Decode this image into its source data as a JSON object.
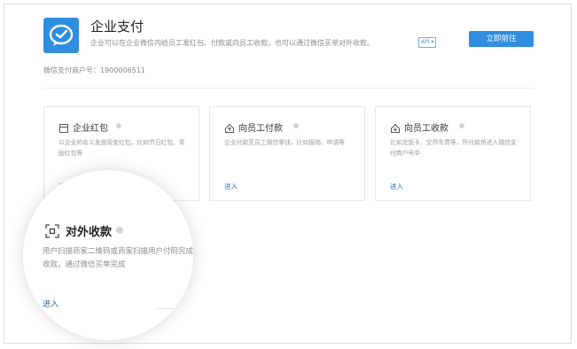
{
  "header": {
    "title": "企业支付",
    "description": "企业可以在企业微信内给员工发红包、付款或向员工收款，也可以通过微信买单对外收款。",
    "api_badge": "API ▾",
    "open_button": "立即前往",
    "merchant_id": "微信支付商户号：1900006511"
  },
  "cards": [
    {
      "title": "企业红包",
      "icon": "envelope-icon",
      "description": "以企业的名义发放现金红包，比如节日红包、奖励红包等",
      "enter": "进入"
    },
    {
      "title": "向员工付款",
      "icon": "payment-out-icon",
      "description": "企业付款至员工微信零钱，比如报销、申请等",
      "enter": "进入"
    },
    {
      "title": "向员工收款",
      "icon": "payment-in-icon",
      "description": "比如充饭卡、交停车费等，所付款将进入微信支付商户号中",
      "enter": "进入"
    }
  ],
  "featured": {
    "title": "对外收款",
    "icon": "scan-qr-icon",
    "description": "用户扫描商家二维码或商家扫描用户付码完成收款，通过微信买单完成",
    "enter": "进入"
  },
  "colors": {
    "accent": "#2f8ede",
    "link": "#2f6fa8",
    "muted_text": "#8a8a8a",
    "border": "#e6e6e6"
  }
}
